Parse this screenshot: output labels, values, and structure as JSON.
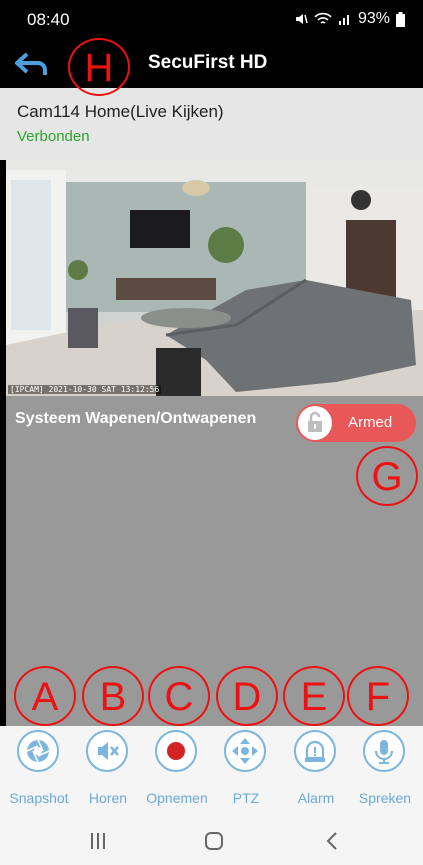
{
  "status_bar": {
    "time": "08:40",
    "battery": "93%"
  },
  "header": {
    "title": "SecuFirst HD",
    "back_icon": "back-arrow-icon"
  },
  "camera": {
    "name": "Cam114 Home(Live Kijken)",
    "status": "Verbonden",
    "timestamp": "[IPCAM] 2021-10-30 SAT 13:12:56"
  },
  "arm": {
    "label": "Systeem Wapenen/Ontwapenen",
    "state": "Armed"
  },
  "toolbar": [
    {
      "label": "Snapshot",
      "icon": "camera-shutter-icon"
    },
    {
      "label": "Horen",
      "icon": "speaker-muted-icon"
    },
    {
      "label": "Opnemen",
      "icon": "record-icon"
    },
    {
      "label": "PTZ",
      "icon": "ptz-arrows-icon"
    },
    {
      "label": "Alarm",
      "icon": "alarm-siren-icon"
    },
    {
      "label": "Spreken",
      "icon": "microphone-icon"
    }
  ],
  "annotations": [
    "A",
    "B",
    "C",
    "D",
    "E",
    "F",
    "G",
    "H"
  ],
  "colors": {
    "accent": "#6aaad6",
    "armed": "#e85858",
    "connected": "#2aa52e",
    "annotation": "#e11111"
  }
}
